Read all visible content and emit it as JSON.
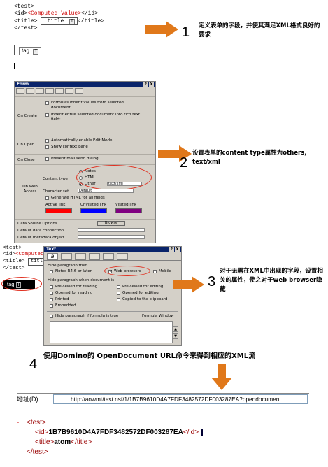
{
  "xml_snippet": {
    "line1": "<test>",
    "line2_open": "<id>",
    "line2_value": "<Computed Value>",
    "line2_close": "</id>",
    "line3_open": "<title>",
    "line3_field": "title",
    "line3_T": "T",
    "line3_close": "</title>",
    "line4": "</test>"
  },
  "tag_field": {
    "label": "tag",
    "T": "T"
  },
  "steps": [
    {
      "num": "1",
      "text": "定义表单的字段，并使其满足XML格式良好的要求"
    },
    {
      "num": "2",
      "text": "设置表单的content type属性为others, text/xml"
    },
    {
      "num": "3",
      "text": "对于无需在XML中出现的字段，设置相关的属性，使之对于web browser隐藏"
    },
    {
      "num": "4",
      "text": "使用Domino的 OpenDocument URL命令来得到相应的XML流"
    }
  ],
  "form_dialog": {
    "title": "Form",
    "title_buttons": [
      "?",
      "X"
    ],
    "on_create_label": "On Create",
    "on_create_opt1": "Formulas inherit values from selected document",
    "on_create_opt2": "Inherit entire selected document into rich text field:",
    "on_open_label": "On Open",
    "on_open_opt1": "Automatically enable Edit Mode",
    "on_open_opt2": "Show context pane",
    "on_close_label": "On Close",
    "on_close_opt1": "Present mail send dialog",
    "web_access_label": "On Web Access",
    "content_type_label": "Content type",
    "ct_notes": "Notes",
    "ct_html": "HTML",
    "ct_other": "Other",
    "ct_other_value": "text/xml",
    "charset_label": "Character set",
    "charset_value": "Default",
    "generate_html": "Generate HTML for all fields",
    "active_link": "Active link",
    "unvisited_link": "Unvisited link",
    "visited_link": "Visited link",
    "data_source_options": "Data Source Options",
    "browse": "Browse",
    "default_data_connection": "Default data connection",
    "default_metadata_object": "Default metadata object"
  },
  "text_dialog": {
    "title": "Text",
    "title_buttons": [
      "?",
      "X"
    ],
    "hide_from": "Hide paragraph from",
    "notes_r46": "Notes R4.6 or later",
    "web_browsers": "Web browsers",
    "mobile": "Mobile",
    "hide_when": "Hide paragraph when document is",
    "previewed_reading": "Previewed for reading",
    "opened_reading": "Opened for reading",
    "printed": "Printed",
    "embedded": "Embedded",
    "previewed_editing": "Previewed for editing",
    "opened_editing": "Opened for editing",
    "copied_clipboard": "Copied to the clipboard",
    "hide_formula": "Hide paragraph if formula is true",
    "formula_window": "Formula Window"
  },
  "behind_xml": {
    "l1": "<test>",
    "l2a": "<id>",
    "l2b": "<Computed V",
    "l3": "<title>",
    "l3f": "titl",
    "l4": "</test>",
    "tag": "tag",
    "T": "T"
  },
  "url_bar": {
    "label": "地址(D)",
    "url": "http://aowmt/test.nsf/1/1B7B9610D4A7FDF3482572DF003287EA?opendocument"
  },
  "xml_result": {
    "minus": "-",
    "test_open": "<test>",
    "id_open": "<id>",
    "id_value": "1B7B9610D4A7FDF3482572DF003287EA",
    "id_close": "</id>",
    "title_open": "<title>",
    "title_value": "atom",
    "title_close": "</title>",
    "test_close": "</test>"
  },
  "colors": {
    "arrow": "#e0781a",
    "ellipse": "#e03020",
    "link_active": "#ff0000",
    "link_unvisited": "#0000ff",
    "link_visited": "#800080"
  }
}
